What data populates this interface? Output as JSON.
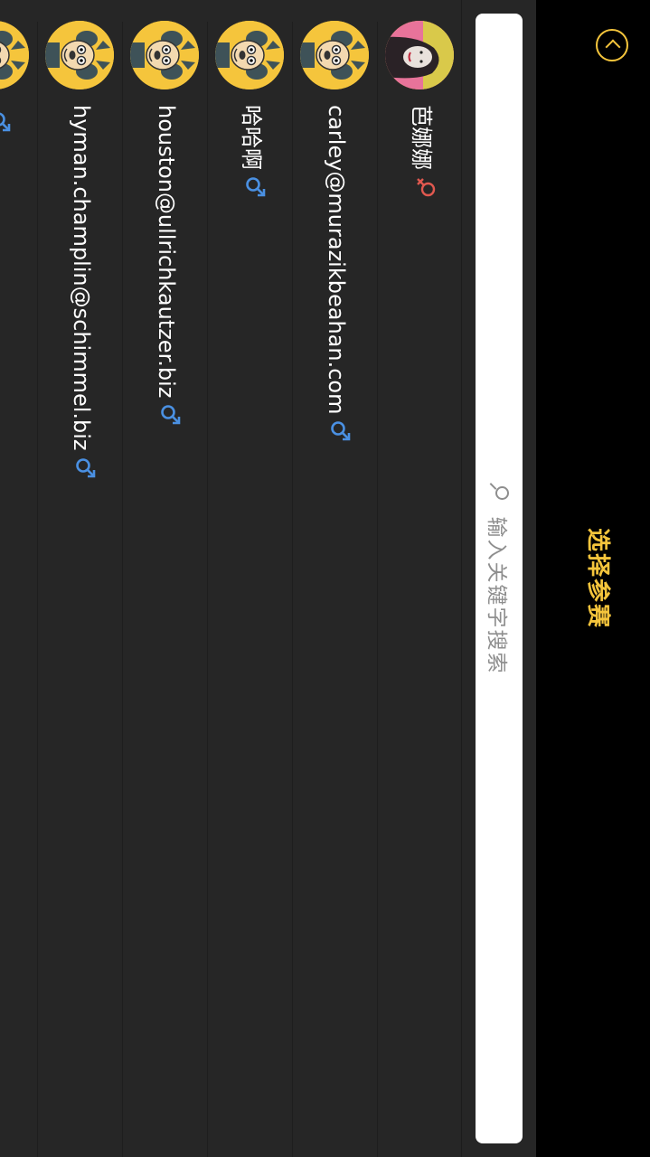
{
  "header": {
    "title": "选择参赛"
  },
  "search": {
    "placeholder": "输入关键字搜索"
  },
  "colors": {
    "accent": "#f5c53c",
    "background": "#262626",
    "navbar": "#000000",
    "male": "#4a90e2",
    "female": "#e0584f"
  },
  "list": {
    "items": [
      {
        "name": "芭娜娜",
        "gender": "female",
        "avatar": "photo-avatar"
      },
      {
        "name": "carley@murazikbeahan.com",
        "gender": "male",
        "avatar": "cartoon-avatar"
      },
      {
        "name": "哈哈啊",
        "gender": "male",
        "avatar": "cartoon-avatar"
      },
      {
        "name": "houston@ullrichkautzer.biz",
        "gender": "male",
        "avatar": "cartoon-avatar"
      },
      {
        "name": "hyman.champlin@schimmel.biz",
        "gender": "male",
        "avatar": "cartoon-avatar"
      },
      {
        "name": "",
        "gender": "male",
        "avatar": "cartoon-avatar"
      }
    ]
  }
}
